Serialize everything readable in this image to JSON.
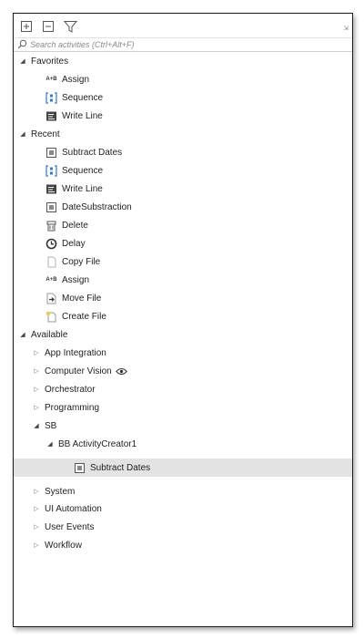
{
  "toolbar": {
    "expand_icon": "expand-all-icon",
    "collapse_icon": "collapse-all-icon",
    "filter_icon": "filter-icon",
    "pin_glyph": "⇲"
  },
  "search": {
    "placeholder": "Search activities (Ctrl+Alt+F)",
    "value": ""
  },
  "tree": {
    "favorites": {
      "label": "Favorites",
      "items": [
        {
          "label": "Assign",
          "icon": "assign-icon"
        },
        {
          "label": "Sequence",
          "icon": "sequence-icon"
        },
        {
          "label": "Write Line",
          "icon": "write-line-icon"
        }
      ]
    },
    "recent": {
      "label": "Recent",
      "items": [
        {
          "label": "Subtract Dates",
          "icon": "activity-icon"
        },
        {
          "label": "Sequence",
          "icon": "sequence-icon"
        },
        {
          "label": "Write Line",
          "icon": "write-line-icon"
        },
        {
          "label": "DateSubstraction",
          "icon": "activity-icon"
        },
        {
          "label": "Delete",
          "icon": "delete-icon"
        },
        {
          "label": "Delay",
          "icon": "clock-icon"
        },
        {
          "label": "Copy File",
          "icon": "copy-file-icon"
        },
        {
          "label": "Assign",
          "icon": "assign-icon"
        },
        {
          "label": "Move File",
          "icon": "move-file-icon"
        },
        {
          "label": "Create File",
          "icon": "create-file-icon"
        }
      ]
    },
    "available": {
      "label": "Available",
      "groups_before": [
        {
          "label": "App Integration"
        },
        {
          "label": "Computer Vision",
          "icon": "eye-icon"
        },
        {
          "label": "Orchestrator"
        },
        {
          "label": "Programming"
        }
      ],
      "sb": {
        "label": "SB",
        "child": {
          "label": "BB ActivityCreator1",
          "items": [
            {
              "label": "Subtract Dates",
              "icon": "activity-icon",
              "selected": true
            }
          ]
        }
      },
      "groups_after": [
        {
          "label": "System"
        },
        {
          "label": "UI Automation"
        },
        {
          "label": "User Events"
        },
        {
          "label": "Workflow"
        }
      ]
    }
  },
  "colors": {
    "selection": "#e3e3e3",
    "accent_blue": "#2b7cd3",
    "folder_yellow": "#f2c94c"
  }
}
